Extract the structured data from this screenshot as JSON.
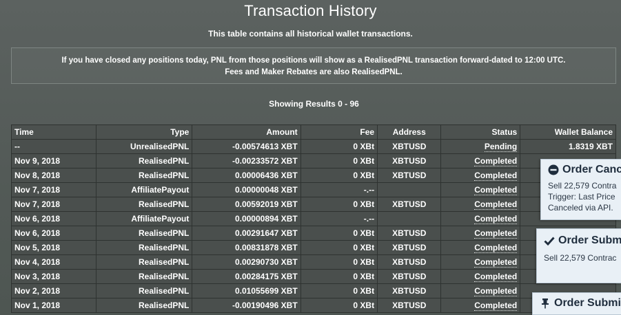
{
  "header": {
    "title": "Transaction History",
    "subtitle": "This table contains all historical wallet transactions."
  },
  "notice": {
    "line1": "If you have closed any positions today, PNL from those positions will show as a RealisedPNL transaction forward-dated to 12:00 UTC.",
    "line2": "Fees and Maker Rebates are also RealisedPNL."
  },
  "results": {
    "label": "Showing Results 0 - 96"
  },
  "table": {
    "columns": [
      "Time",
      "Type",
      "Amount",
      "Fee",
      "Address",
      "Status",
      "Wallet Balance"
    ],
    "rows": [
      {
        "time": "--",
        "type": "UnrealisedPNL",
        "amount": "-0.00574613 XBT",
        "fee": "0 XBt",
        "address": "XBTUSD",
        "status": "Pending",
        "balance": "1.8319 XBT"
      },
      {
        "time": "Nov 9, 2018",
        "type": "RealisedPNL",
        "amount": "-0.00233572 XBT",
        "fee": "0 XBt",
        "address": "XBTUSD",
        "status": "Completed",
        "balance": ""
      },
      {
        "time": "Nov 8, 2018",
        "type": "RealisedPNL",
        "amount": "0.00006436 XBT",
        "fee": "0 XBt",
        "address": "XBTUSD",
        "status": "Completed",
        "balance": ""
      },
      {
        "time": "Nov 7, 2018",
        "type": "AffiliatePayout",
        "amount": "0.00000048 XBT",
        "fee": "-.--",
        "address": "",
        "status": "Completed",
        "balance": ""
      },
      {
        "time": "Nov 7, 2018",
        "type": "RealisedPNL",
        "amount": "0.00592019 XBT",
        "fee": "0 XBt",
        "address": "XBTUSD",
        "status": "Completed",
        "balance": ""
      },
      {
        "time": "Nov 6, 2018",
        "type": "AffiliatePayout",
        "amount": "0.00000894 XBT",
        "fee": "-.--",
        "address": "",
        "status": "Completed",
        "balance": ""
      },
      {
        "time": "Nov 6, 2018",
        "type": "RealisedPNL",
        "amount": "0.00291647 XBT",
        "fee": "0 XBt",
        "address": "XBTUSD",
        "status": "Completed",
        "balance": ""
      },
      {
        "time": "Nov 5, 2018",
        "type": "RealisedPNL",
        "amount": "0.00831878 XBT",
        "fee": "0 XBt",
        "address": "XBTUSD",
        "status": "Completed",
        "balance": ""
      },
      {
        "time": "Nov 4, 2018",
        "type": "RealisedPNL",
        "amount": "0.00290730 XBT",
        "fee": "0 XBt",
        "address": "XBTUSD",
        "status": "Completed",
        "balance": ""
      },
      {
        "time": "Nov 3, 2018",
        "type": "RealisedPNL",
        "amount": "0.00284175 XBT",
        "fee": "0 XBt",
        "address": "XBTUSD",
        "status": "Completed",
        "balance": ""
      },
      {
        "time": "Nov 2, 2018",
        "type": "RealisedPNL",
        "amount": "0.01055699 XBT",
        "fee": "0 XBt",
        "address": "XBTUSD",
        "status": "Completed",
        "balance": ""
      },
      {
        "time": "Nov 1, 2018",
        "type": "RealisedPNL",
        "amount": "-0.00190496 XBT",
        "fee": "0 XBt",
        "address": "XBTUSD",
        "status": "Completed",
        "balance": ""
      }
    ]
  },
  "toasts": {
    "cancel": {
      "icon": "minus-circle-icon",
      "title": "Order Canc",
      "line1": "Sell 22,579 Contra",
      "line2": "Trigger: Last Price",
      "line3": "Canceled via API."
    },
    "submit1": {
      "icon": "checkmark-icon",
      "title": "Order Subm",
      "line1": "Sell 22,579 Contrac"
    },
    "submit2": {
      "icon": "pushpin-icon",
      "title": "Order Submi"
    }
  },
  "colors": {
    "background": "#565d5a",
    "cell": "#4a4f4d",
    "border": "#2e3230",
    "toast_bg": "#e9f0f6",
    "toast_text": "#1f2d3d"
  }
}
